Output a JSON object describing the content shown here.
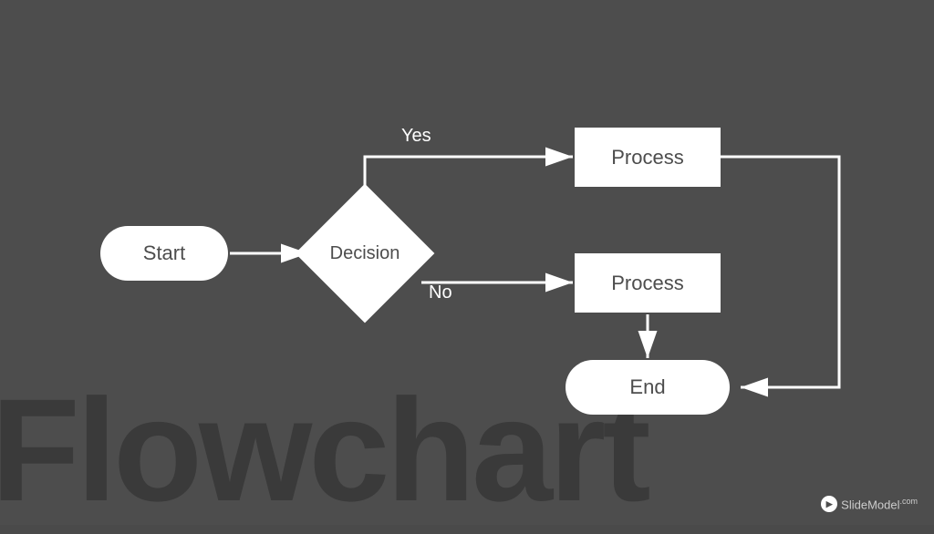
{
  "slide": {
    "background": "#4d4d4d"
  },
  "watermark": {
    "text": "Flowchart"
  },
  "logo": {
    "icon": "▶",
    "name": "SlideModel",
    "suffix": ".com"
  },
  "shapes": {
    "start": "Start",
    "decision": "Decision",
    "process_top": "Process",
    "process_bottom": "Process",
    "end": "End"
  },
  "labels": {
    "yes": "Yes",
    "no": "No"
  }
}
